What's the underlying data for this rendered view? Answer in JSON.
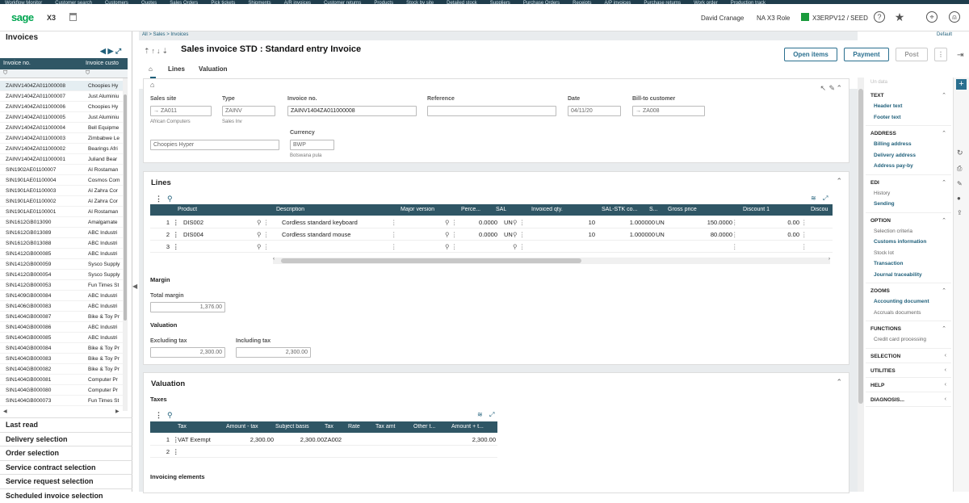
{
  "topnav": [
    "Workflow Monitor",
    "Customer search",
    "Customers",
    "Quotes",
    "Sales Orders",
    "Pick tickets",
    "Shipments",
    "A/R invoices",
    "Customer returns",
    "Products",
    "Stock by site",
    "Detailed stock",
    "Suppliers",
    "Purchase Orders",
    "Receipts",
    "A/P invoices",
    "Purchase returns",
    "Work order",
    "Production track"
  ],
  "header": {
    "logo": "sage",
    "product": "X3",
    "user": "David Cranage",
    "role": "NA X3 Role",
    "folder": "X3ERPV12 / SEED",
    "default": "Default"
  },
  "left": {
    "title": "Invoices",
    "col1": "Invoice no.",
    "col2": "Invoice custo",
    "rows": [
      [
        "ZAINV1404ZA011000008",
        "Choopies Hy"
      ],
      [
        "ZAINV1404ZA011000007",
        "Just Aluminiu"
      ],
      [
        "ZAINV1404ZA011000006",
        "Choopies Hy"
      ],
      [
        "ZAINV1404ZA011000005",
        "Just Aluminiu"
      ],
      [
        "ZAINV1404ZA011000004",
        "Bell Equipme"
      ],
      [
        "ZAINV1404ZA011000003",
        "Zimbabwe Le"
      ],
      [
        "ZAINV1404ZA011000002",
        "Bearings Afri"
      ],
      [
        "ZAINV1404ZA011000001",
        "Juliand Bear"
      ],
      [
        "SIN1902AE01100007",
        "Al Rostaman"
      ],
      [
        "SIN1901AE01100004",
        "Cosmos Com"
      ],
      [
        "SIN1901AE01100003",
        "Al Zahra Cor"
      ],
      [
        "SIN1901AE01100002",
        "Al Zahra Cor"
      ],
      [
        "SIN1901AE01100001",
        "Al Rostaman"
      ],
      [
        "SIN1612GB013090",
        "Amalgamate"
      ],
      [
        "SIN1612GB013089",
        "ABC Industri"
      ],
      [
        "SIN1612GB013088",
        "ABC Industri"
      ],
      [
        "SIN1412GB000085",
        "ABC Industri"
      ],
      [
        "SIN1412GB000059",
        "Sysco Supply"
      ],
      [
        "SIN1412GB000054",
        "Sysco Supply"
      ],
      [
        "SIN1412GB000053",
        "Fun Times St"
      ],
      [
        "SIN1409GB000084",
        "ABC Industri"
      ],
      [
        "SIN1406GB000083",
        "ABC Industri"
      ],
      [
        "SIN1404GB000087",
        "Bike & Toy Pr"
      ],
      [
        "SIN1404GB000086",
        "ABC Industri"
      ],
      [
        "SIN1404GB000085",
        "ABC Industri"
      ],
      [
        "SIN1404GB000084",
        "Bike & Toy Pr"
      ],
      [
        "SIN1404GB000083",
        "Bike & Toy Pr"
      ],
      [
        "SIN1404GB000082",
        "Bike & Toy Pr"
      ],
      [
        "SIN1404GB000081",
        "Computer Pr"
      ],
      [
        "SIN1404GB000080",
        "Computer Pr"
      ],
      [
        "SIN1404GB000073",
        "Fun Times St"
      ]
    ],
    "sections": [
      "Last read",
      "Delivery selection",
      "Order selection",
      "Service contract selection",
      "Service request selection",
      "Scheduled invoice selection"
    ]
  },
  "main": {
    "breadcrumb": [
      "All",
      "Sales",
      "Invoices"
    ],
    "title": "Sales invoice STD : Standard entry Invoice",
    "buttons": {
      "open_items": "Open items",
      "payment": "Payment",
      "post": "Post"
    },
    "tabs": [
      "Lines",
      "Valuation"
    ],
    "header_fields": {
      "sales_site_label": "Sales site",
      "sales_site": "ZA011",
      "sales_site_desc": "African Computers",
      "type_label": "Type",
      "type": "ZAINV",
      "type_desc": "Sales Inv",
      "invoice_no_label": "Invoice no.",
      "invoice_no": "ZAINV1404ZA011000008",
      "reference_label": "Reference",
      "reference": "",
      "date_label": "Date",
      "date": "04/11/20",
      "bill_to_label": "Bill-to customer",
      "bill_to": "ZA008",
      "customer_name": "Choopies Hyper",
      "currency_label": "Currency",
      "currency": "BWP",
      "currency_desc": "Botswana pula"
    },
    "lines": {
      "title": "Lines",
      "columns": [
        "Product",
        "Description",
        "Major version",
        "Perce...",
        "SAL",
        "Invoiced qty.",
        "SAL-STK co...",
        "S...",
        "Gross price",
        "Discount 1",
        "Discou"
      ],
      "rows": [
        {
          "n": "1",
          "product": "DIS002",
          "desc": "Cordless standard keyboard",
          "perc": "0.0000",
          "sal": "UN",
          "qty": "10",
          "conv": "1.000000",
          "s": "UN",
          "price": "150.0000",
          "disc": "0.00"
        },
        {
          "n": "2",
          "product": "DIS004",
          "desc": "Cordless standard mouse",
          "perc": "0.0000",
          "sal": "UN",
          "qty": "10",
          "conv": "1.000000",
          "s": "UN",
          "price": "80.0000",
          "disc": "0.00"
        },
        {
          "n": "3",
          "product": "",
          "desc": "",
          "perc": "",
          "sal": "",
          "qty": "",
          "conv": "",
          "s": "",
          "price": "",
          "disc": ""
        }
      ],
      "margin_title": "Margin",
      "total_margin_label": "Total margin",
      "total_margin": "1,376.00",
      "valuation_title": "Valuation",
      "excl_label": "Excluding tax",
      "excl": "2,300.00",
      "incl_label": "Including tax",
      "incl": "2,300.00"
    },
    "valuation": {
      "title": "Valuation",
      "taxes_title": "Taxes",
      "columns": [
        "Tax",
        "Amount - tax",
        "Subject basis",
        "Tax",
        "Rate",
        "Tax amt",
        "Other t...",
        "Amount + t..."
      ],
      "rows": [
        {
          "n": "1",
          "tax": "VAT Exempt",
          "amount": "2,300.00",
          "basis": "2,300.00",
          "code": "ZA002",
          "rate": "",
          "taxamt": "",
          "other": "",
          "total": "2,300.00"
        },
        {
          "n": "2",
          "tax": "",
          "amount": "",
          "basis": "",
          "code": "",
          "rate": "",
          "taxamt": "",
          "other": "",
          "total": ""
        }
      ],
      "invoicing_title": "Invoicing elements"
    }
  },
  "right": {
    "search": "Un data",
    "groups": [
      {
        "title": "TEXT",
        "items": [
          "Header text",
          "Footer text"
        ]
      },
      {
        "title": "ADDRESS",
        "items": [
          "Billing address",
          "Delivery address",
          "Address pay-by"
        ]
      },
      {
        "title": "EDI",
        "items": [
          "History",
          "Sending"
        ]
      },
      {
        "title": "OPTION",
        "items": [
          "Selection criteria",
          "Customs information",
          "Stock lot",
          "Transaction",
          "Journal traceability"
        ]
      },
      {
        "title": "ZOOMS",
        "items": [
          "Accounting document",
          "Accruals documents"
        ]
      },
      {
        "title": "FUNCTIONS",
        "items": [
          "Credit card processing"
        ]
      },
      {
        "title": "SELECTION",
        "items": []
      },
      {
        "title": "UTILITIES",
        "items": []
      },
      {
        "title": "HELP",
        "items": []
      },
      {
        "title": "DIAGNOSIS...",
        "items": []
      }
    ]
  },
  "colors": {
    "grid_header": "#2f5665",
    "accent": "#2a6f8f",
    "brand": "#00a651"
  }
}
